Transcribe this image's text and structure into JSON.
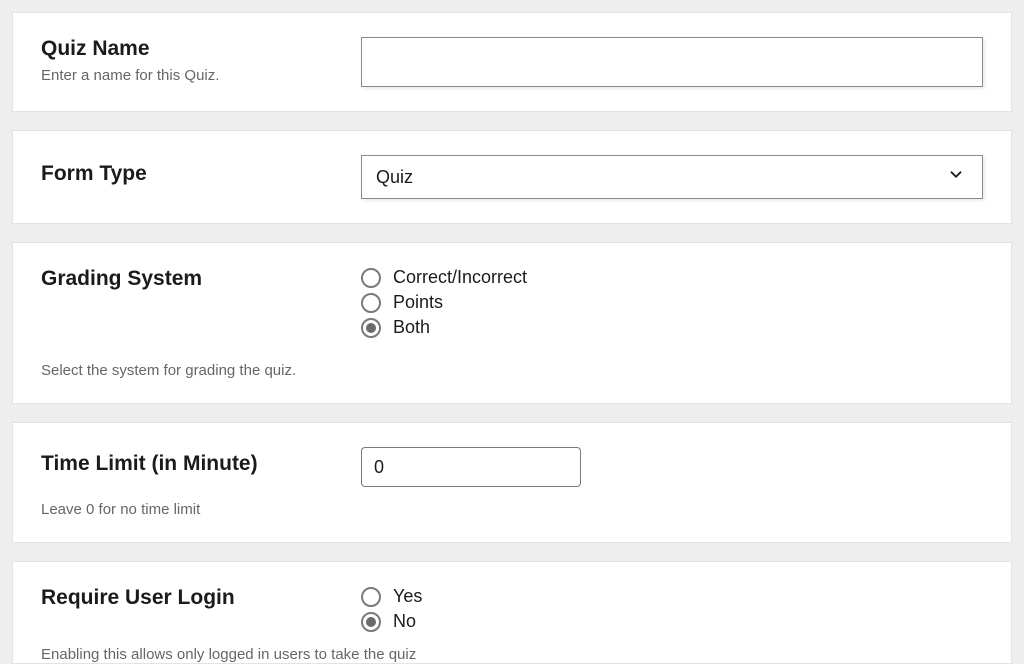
{
  "quizName": {
    "label": "Quiz Name",
    "desc": "Enter a name for this Quiz.",
    "value": ""
  },
  "formType": {
    "label": "Form Type",
    "selected": "Quiz"
  },
  "grading": {
    "label": "Grading System",
    "desc": "Select the system for grading the quiz.",
    "options": {
      "opt1": "Correct/Incorrect",
      "opt2": "Points",
      "opt3": "Both"
    },
    "selected": "opt3"
  },
  "timeLimit": {
    "label": "Time Limit (in Minute)",
    "desc": "Leave 0 for no time limit",
    "value": "0"
  },
  "requireLogin": {
    "label": "Require User Login",
    "desc": "Enabling this allows only logged in users to take the quiz",
    "options": {
      "yes": "Yes",
      "no": "No"
    },
    "selected": "no"
  }
}
